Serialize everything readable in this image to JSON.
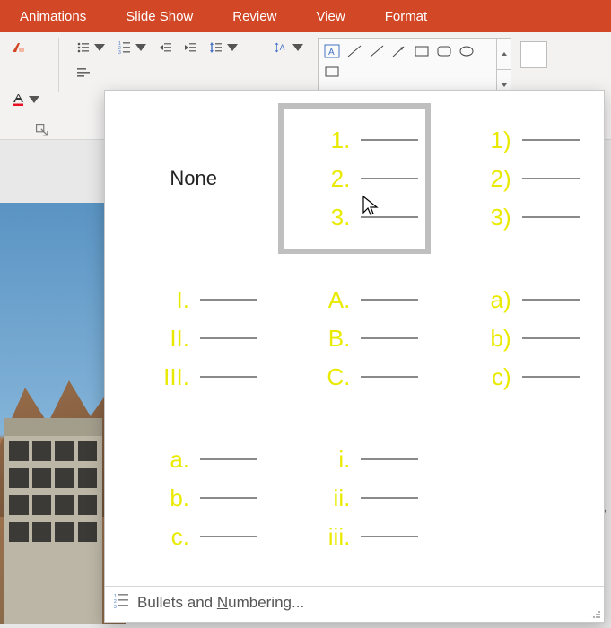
{
  "ribbon": {
    "tabs": [
      "Animations",
      "Slide Show",
      "Review",
      "View",
      "Format"
    ]
  },
  "gallery": {
    "none_label": "None",
    "footer_label_pre": "Bullets and ",
    "footer_label_underline": "N",
    "footer_label_post": "umbering...",
    "tiles": [
      {
        "kind": "none"
      },
      {
        "kind": "list",
        "labels": [
          "1.",
          "2.",
          "3."
        ],
        "selected": true
      },
      {
        "kind": "list",
        "labels": [
          "1)",
          "2)",
          "3)"
        ]
      },
      {
        "kind": "list",
        "labels": [
          "I.",
          "II.",
          "III."
        ]
      },
      {
        "kind": "list",
        "labels": [
          "A.",
          "B.",
          "C."
        ]
      },
      {
        "kind": "list",
        "labels": [
          "a)",
          "b)",
          "c)"
        ]
      },
      {
        "kind": "list",
        "labels": [
          "a.",
          "b.",
          "c."
        ]
      },
      {
        "kind": "list",
        "labels": [
          "i.",
          "ii.",
          "iii."
        ]
      }
    ]
  },
  "shapes": [
    "text-box",
    "line",
    "line",
    "arrow",
    "rect",
    "rounded-rect",
    "ellipse",
    "rect"
  ],
  "colors": {
    "accent": "#d24726",
    "numbering": "#eaea00"
  }
}
